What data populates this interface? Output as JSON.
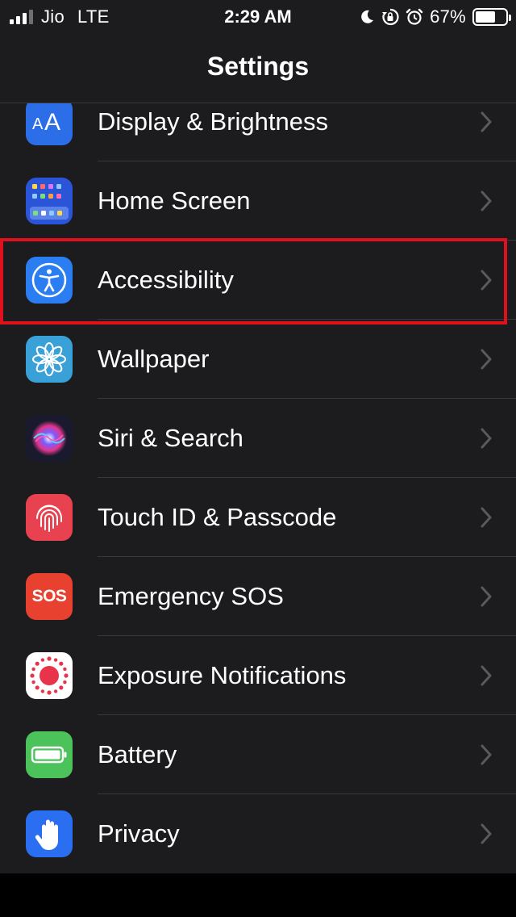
{
  "status_bar": {
    "carrier": "Jio",
    "network": "LTE",
    "time": "2:29 AM",
    "battery_percent_label": "67%",
    "battery_level": 0.67,
    "icons": [
      "moon-icon",
      "rotation-lock-icon",
      "alarm-icon"
    ]
  },
  "nav": {
    "title": "Settings"
  },
  "highlight_color": "#e0101c",
  "rows": [
    {
      "label": "Display & Brightness",
      "icon": "display-brightness-icon",
      "color": "#2c6ee8"
    },
    {
      "label": "Home Screen",
      "icon": "home-screen-icon",
      "color": "#2a55d6"
    },
    {
      "label": "Accessibility",
      "icon": "accessibility-icon",
      "color": "#2a7ef2"
    },
    {
      "label": "Wallpaper",
      "icon": "wallpaper-icon",
      "color": "#3aa0d8"
    },
    {
      "label": "Siri & Search",
      "icon": "siri-icon",
      "color": "#1a1a2e"
    },
    {
      "label": "Touch ID & Passcode",
      "icon": "fingerprint-icon",
      "color": "#e8414f"
    },
    {
      "label": "Emergency SOS",
      "icon": "sos-icon",
      "icon_text": "SOS",
      "color": "#e8412f"
    },
    {
      "label": "Exposure Notifications",
      "icon": "exposure-notifications-icon",
      "color": "#ffffff"
    },
    {
      "label": "Battery",
      "icon": "battery-icon",
      "color": "#4cc25a"
    },
    {
      "label": "Privacy",
      "icon": "hand-icon",
      "color": "#2a6ef2"
    }
  ]
}
